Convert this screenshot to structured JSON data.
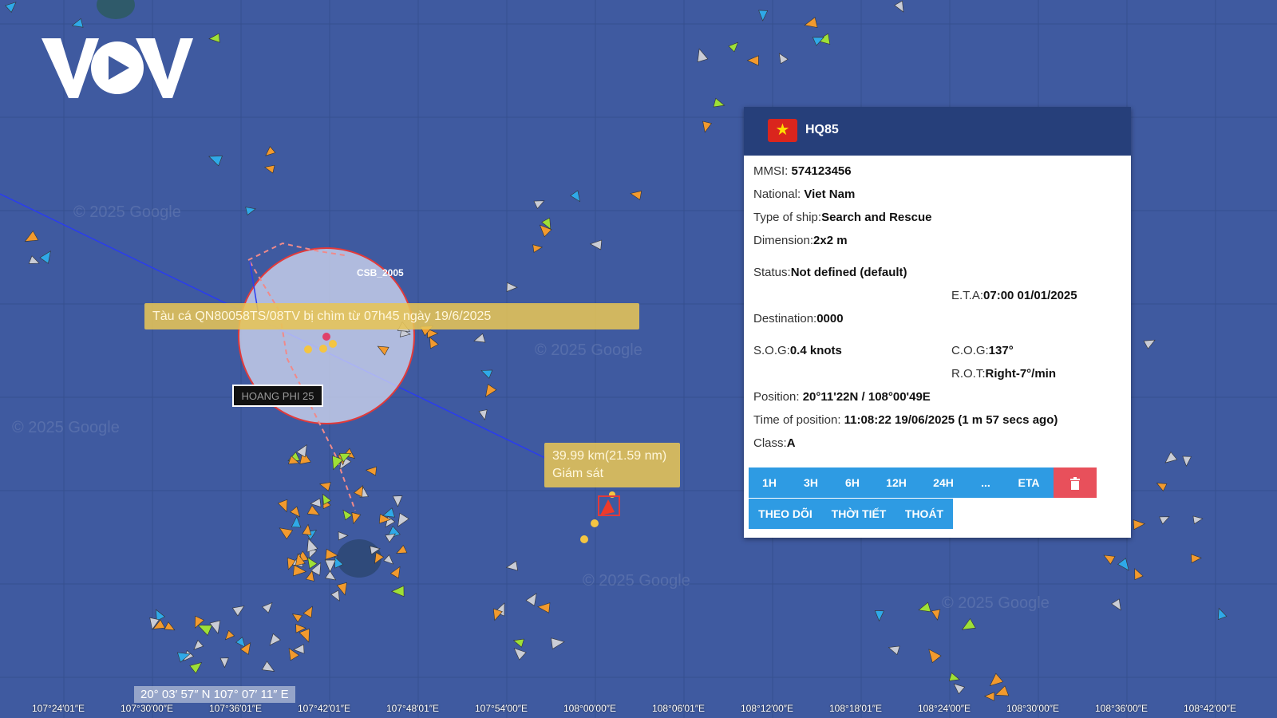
{
  "brand": {
    "logo_text": "VOV"
  },
  "popup": {
    "ship_name": "HQ85",
    "flag": "vn-flag",
    "mmsi_label": "MMSI:",
    "mmsi": "574123456",
    "national_label": "National:",
    "national": "Viet Nam",
    "type_label": "Type of ship:",
    "type": "Search and Rescue",
    "dimension_label": "Dimension:",
    "dimension": "2x2 m",
    "status_label": "Status:",
    "status": "Not defined (default)",
    "eta_label": "E.T.A:",
    "eta": "07:00 01/01/2025",
    "destination_label": "Destination:",
    "destination": "0000",
    "sog_label": "S.O.G:",
    "sog": "0.4 knots",
    "cog_label": "C.O.G:",
    "cog": "137°",
    "rot_label": "R.O.T:",
    "rot": "Right-7°/min",
    "position_label": "Position:",
    "position": "20°11'22N / 108°00'49E",
    "time_label": "Time of position:",
    "time": "11:08:22 19/06/2025 (1 m 57 secs ago)",
    "class_label": "Class:",
    "class": "A",
    "buttons": {
      "b1h": "1H",
      "b3h": "3H",
      "b6h": "6H",
      "b12h": "12H",
      "b24h": "24H",
      "more": "...",
      "eta": "ETA",
      "follow": "THEO DÕI",
      "weather": "THỜI TIẾT",
      "exit": "THOÁT"
    }
  },
  "map": {
    "incident_label": "Tàu cá QN80058TS/08TV bị chìm từ 07h45 ngày 19/6/2025",
    "csb_label": "CSB_2005",
    "vessel_tag": "HOANG PHI 25",
    "distance_line1": "39.99 km(21.59 nm)",
    "distance_line2": "Giám sát",
    "coord_readout": "20° 03′ 57″ N 107° 07′ 11″ E",
    "watermark": "© 2025 Google",
    "longitudes": [
      "107°24′01″E",
      "107°30′00″E",
      "107°36′01″E",
      "107°42′01″E",
      "107°48′01″E",
      "107°54′00″E",
      "108°00′00″E",
      "108°06′01″E",
      "108°12′00″E",
      "108°18′01″E",
      "108°24′00″E",
      "108°30′00″E",
      "108°36′00″E",
      "108°42′00″E"
    ]
  }
}
